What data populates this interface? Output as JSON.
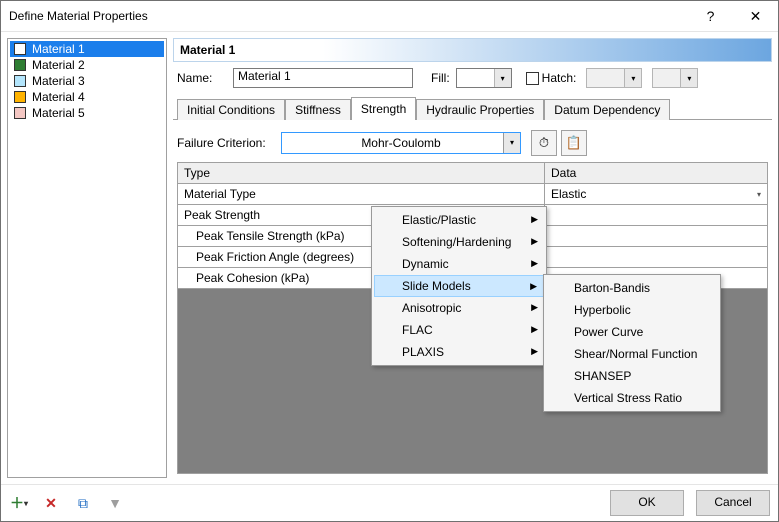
{
  "window": {
    "title": "Define Material Properties"
  },
  "materials": {
    "items": [
      {
        "label": "Material 1",
        "swatch": "#ffffff",
        "selected": true
      },
      {
        "label": "Material 2",
        "swatch": "#2e7d32",
        "selected": false
      },
      {
        "label": "Material 3",
        "swatch": "#b3e5fc",
        "selected": false
      },
      {
        "label": "Material 4",
        "swatch": "#ffb300",
        "selected": false
      },
      {
        "label": "Material 5",
        "swatch": "#f4c7c3",
        "selected": false
      }
    ]
  },
  "heading": "Material 1",
  "form": {
    "name_label": "Name:",
    "name_value": "Material 1",
    "fill_label": "Fill:",
    "hatch_label": "Hatch:"
  },
  "tabs": {
    "items": [
      {
        "label": "Initial Conditions"
      },
      {
        "label": "Stiffness"
      },
      {
        "label": "Strength"
      },
      {
        "label": "Hydraulic Properties"
      },
      {
        "label": "Datum Dependency"
      }
    ],
    "active_index": 2
  },
  "criterion": {
    "label": "Failure Criterion:",
    "value": "Mohr-Coulomb"
  },
  "grid": {
    "col_a": "Type",
    "col_b": "Data",
    "rows": [
      {
        "a": "Material Type",
        "b": "Elastic",
        "dropdown": true
      },
      {
        "a": "Peak Strength",
        "b": "",
        "section": true
      },
      {
        "a": "Peak Tensile Strength (kPa)",
        "b": "",
        "indent": true
      },
      {
        "a": "Peak Friction Angle (degrees)",
        "b": "",
        "indent": true
      },
      {
        "a": "Peak Cohesion (kPa)",
        "b": "",
        "indent": true
      }
    ]
  },
  "menu_primary": {
    "items": [
      {
        "label": "Elastic/Plastic",
        "submenu": true
      },
      {
        "label": "Softening/Hardening",
        "submenu": true
      },
      {
        "label": "Dynamic",
        "submenu": true
      },
      {
        "label": "Slide Models",
        "submenu": true,
        "hover": true
      },
      {
        "label": "Anisotropic",
        "submenu": true
      },
      {
        "label": "FLAC",
        "submenu": true
      },
      {
        "label": "PLAXIS",
        "submenu": true
      }
    ]
  },
  "menu_secondary": {
    "items": [
      {
        "label": "Barton-Bandis"
      },
      {
        "label": "Hyperbolic"
      },
      {
        "label": "Power Curve"
      },
      {
        "label": "Shear/Normal Function"
      },
      {
        "label": "SHANSEP"
      },
      {
        "label": "Vertical Stress Ratio"
      }
    ]
  },
  "footer": {
    "ok": "OK",
    "cancel": "Cancel"
  }
}
